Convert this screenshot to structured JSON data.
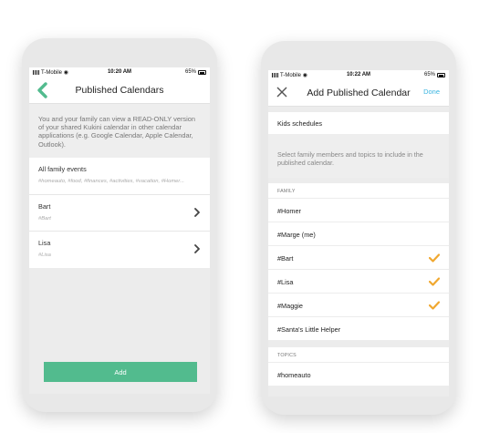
{
  "phones": {
    "left": {
      "status": {
        "carrier": "T-Mobile",
        "time": "10:20 AM",
        "battery": "65%"
      },
      "header": {
        "title": "Published Calendars",
        "back_icon": "chevron-left-icon"
      },
      "intro": "You and your family can view a READ-ONLY version of your shared Kukini calendar in other calendar applications (e.g. Google Calendar, Apple Calendar, Outlook).",
      "calendars": [
        {
          "label": "All family events",
          "subtitle": "#homeauto, #food, #finances, #activities, #vacation, #Homer...",
          "chevron": false
        },
        {
          "label": "Bart",
          "subtitle": "#Bart",
          "chevron": true
        },
        {
          "label": "Lisa",
          "subtitle": "#Lisa",
          "chevron": true
        }
      ],
      "add_button": "Add",
      "accent_color": "#52bb8e"
    },
    "right": {
      "status": {
        "carrier": "T-Mobile",
        "time": "10:22 AM",
        "battery": "65%"
      },
      "header": {
        "title": "Add Published Calendar",
        "close_icon": "close-icon",
        "done_label": "Done"
      },
      "name_field": {
        "value": "Kids schedules"
      },
      "description": "Select family members and topics to include in the published calendar.",
      "family": {
        "heading": "FAMILY",
        "members": [
          {
            "label": "#Homer",
            "checked": false
          },
          {
            "label": "#Marge (me)",
            "checked": false
          },
          {
            "label": "#Bart",
            "checked": true
          },
          {
            "label": "#Lisa",
            "checked": true
          },
          {
            "label": "#Maggie",
            "checked": true
          },
          {
            "label": "#Santa's Little Helper",
            "checked": false
          }
        ]
      },
      "topics": {
        "heading": "TOPICS",
        "items": [
          {
            "label": "#homeauto",
            "checked": false
          }
        ]
      },
      "check_color": "#f0a830",
      "link_color": "#38b4e0"
    }
  }
}
